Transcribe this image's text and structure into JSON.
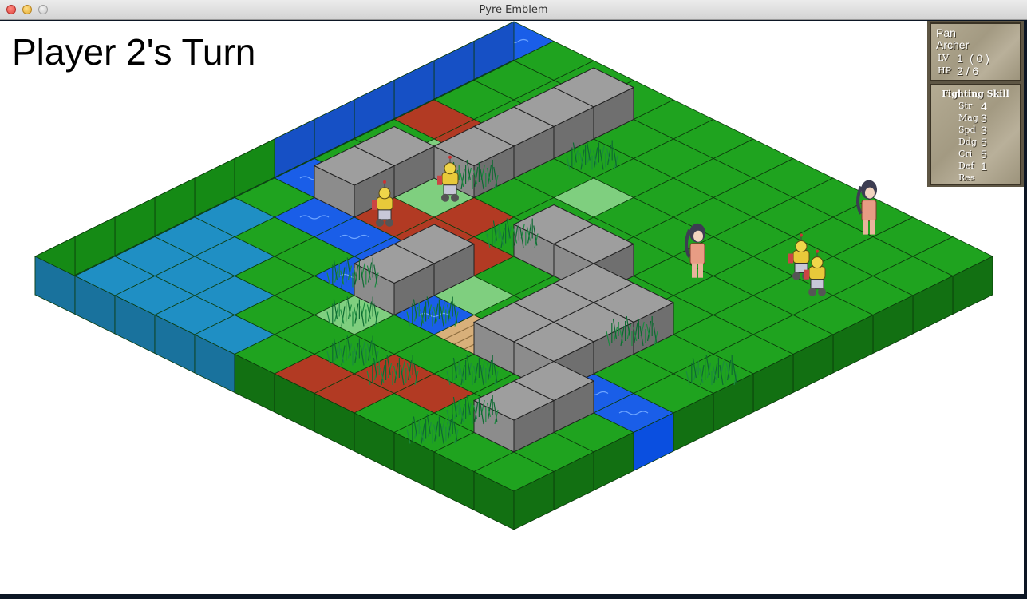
{
  "window": {
    "title": "Pyre Emblem"
  },
  "hud": {
    "turn_label": "Player 2's Turn"
  },
  "unit_panel": {
    "name": "Pan",
    "class": "Archer",
    "level_label": "LV",
    "level": "1",
    "level_extra": "( 0 )",
    "hp_label": "HP",
    "hp": "2 / 6"
  },
  "skill_panel": {
    "title": "Fighting Skill",
    "stats": [
      {
        "label": "Str",
        "value": "4"
      },
      {
        "label": "Mag",
        "value": "3"
      },
      {
        "label": "Spd",
        "value": "3"
      },
      {
        "label": "Ddg",
        "value": "5"
      },
      {
        "label": "Cri",
        "value": "5"
      },
      {
        "label": "Def",
        "value": "1"
      },
      {
        "label": "Res",
        "value": ""
      }
    ]
  },
  "colors": {
    "grass": "#1fa31f",
    "grass_side_left": "#158a15",
    "grass_side_right": "#127012",
    "river": "#1a5ee8",
    "lake": "#1f8fc4",
    "attack_range": "#b23a23",
    "move_range": "#7fcf7f",
    "stone": "#9e9e9e",
    "bridge": "#d8b07a"
  },
  "map": {
    "size": 12,
    "tiles_note": "grid[r][c]: G grass, W river, L lake, B bridge, R attack-range, M move-range",
    "grid": [
      "WGGGGGGGGGGG",
      "WGGGGGGGGGGG",
      "WGGGGGGGGGGG",
      "WGGGGMGGGGGG",
      "WGMMGGGGGGGG",
      "WGMMGGGGGGGG",
      "BWWGGGGGGGGG",
      "GGWWWGGGGGGG",
      "GGGGWWWBWWWW",
      "GGGGGGGGGGGG",
      "GGGGGGGGGGGG",
      "GGGGGGGGGGGG"
    ]
  },
  "units": [
    {
      "name": "robot-player-1",
      "team": "player"
    },
    {
      "name": "robot-player-2",
      "team": "player"
    },
    {
      "name": "robot-enemy-1",
      "team": "enemy"
    },
    {
      "name": "robot-enemy-2",
      "team": "enemy"
    },
    {
      "name": "archer-enemy-1",
      "team": "enemy"
    },
    {
      "name": "archer-enemy-2",
      "team": "enemy"
    }
  ]
}
